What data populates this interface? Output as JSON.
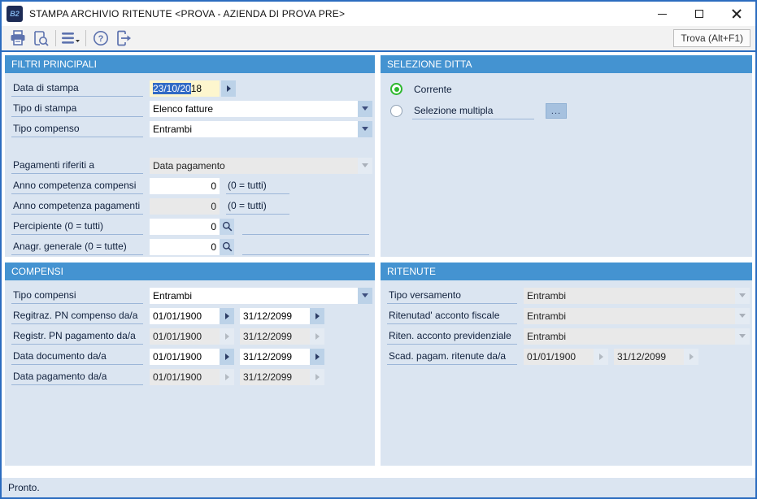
{
  "window": {
    "title": "STAMPA ARCHIVIO RITENUTE <PROVA - AZIENDA DI PROVA PRE>",
    "icon_text": "B2"
  },
  "toolbar": {
    "find_label": "Trova (Alt+F1)"
  },
  "filtri": {
    "title": "FILTRI PRINCIPALI",
    "data_stampa_label": "Data di stampa",
    "data_stampa_selected": "23/10/20",
    "data_stampa_tail": "18",
    "tipo_stampa_label": "Tipo di stampa",
    "tipo_stampa_value": "Elenco fatture",
    "tipo_compenso_label": "Tipo compenso",
    "tipo_compenso_value": "Entrambi",
    "pagamenti_label": "Pagamenti riferiti a",
    "pagamenti_value": "Data pagamento",
    "anno_compensi_label": "Anno competenza compensi",
    "anno_compensi_value": "0",
    "anno_compensi_hint": "(0 = tutti)",
    "anno_pagamenti_label": "Anno competenza pagamenti",
    "anno_pagamenti_value": "0",
    "anno_pagamenti_hint": "(0 = tutti)",
    "percipiente_label": "Percipiente (0 = tutti)",
    "percipiente_value": "0",
    "anagr_label": "Anagr. generale (0 = tutte)",
    "anagr_value": "0"
  },
  "selezione_ditta": {
    "title": "SELEZIONE DITTA",
    "option_corrente": "Corrente",
    "option_multipla": "Selezione multipla",
    "browse_label": "..."
  },
  "compensi": {
    "title": "COMPENSI",
    "tipo_label": "Tipo compensi",
    "tipo_value": "Entrambi",
    "registraz_label": "Regitraz. PN compenso da/a",
    "registraz_from": "01/01/1900",
    "registraz_to": "31/12/2099",
    "registr_label": "Registr. PN pagamento da/a",
    "registr_from": "01/01/1900",
    "registr_to": "31/12/2099",
    "doc_label": "Data documento da/a",
    "doc_from": "01/01/1900",
    "doc_to": "31/12/2099",
    "pag_label": "Data pagamento da/a",
    "pag_from": "01/01/1900",
    "pag_to": "31/12/2099"
  },
  "ritenute": {
    "title": "RITENUTE",
    "versamento_label": "Tipo versamento",
    "versamento_value": "Entrambi",
    "fiscale_label": "Ritenutad' acconto fiscale",
    "fiscale_value": "Entrambi",
    "previdenziale_label": "Riten. acconto previdenziale",
    "previdenziale_value": "Entrambi",
    "scad_label": "Scad. pagam. ritenute da/a",
    "scad_from": "01/01/1900",
    "scad_to": "31/12/2099"
  },
  "status": {
    "text": "Pronto."
  }
}
